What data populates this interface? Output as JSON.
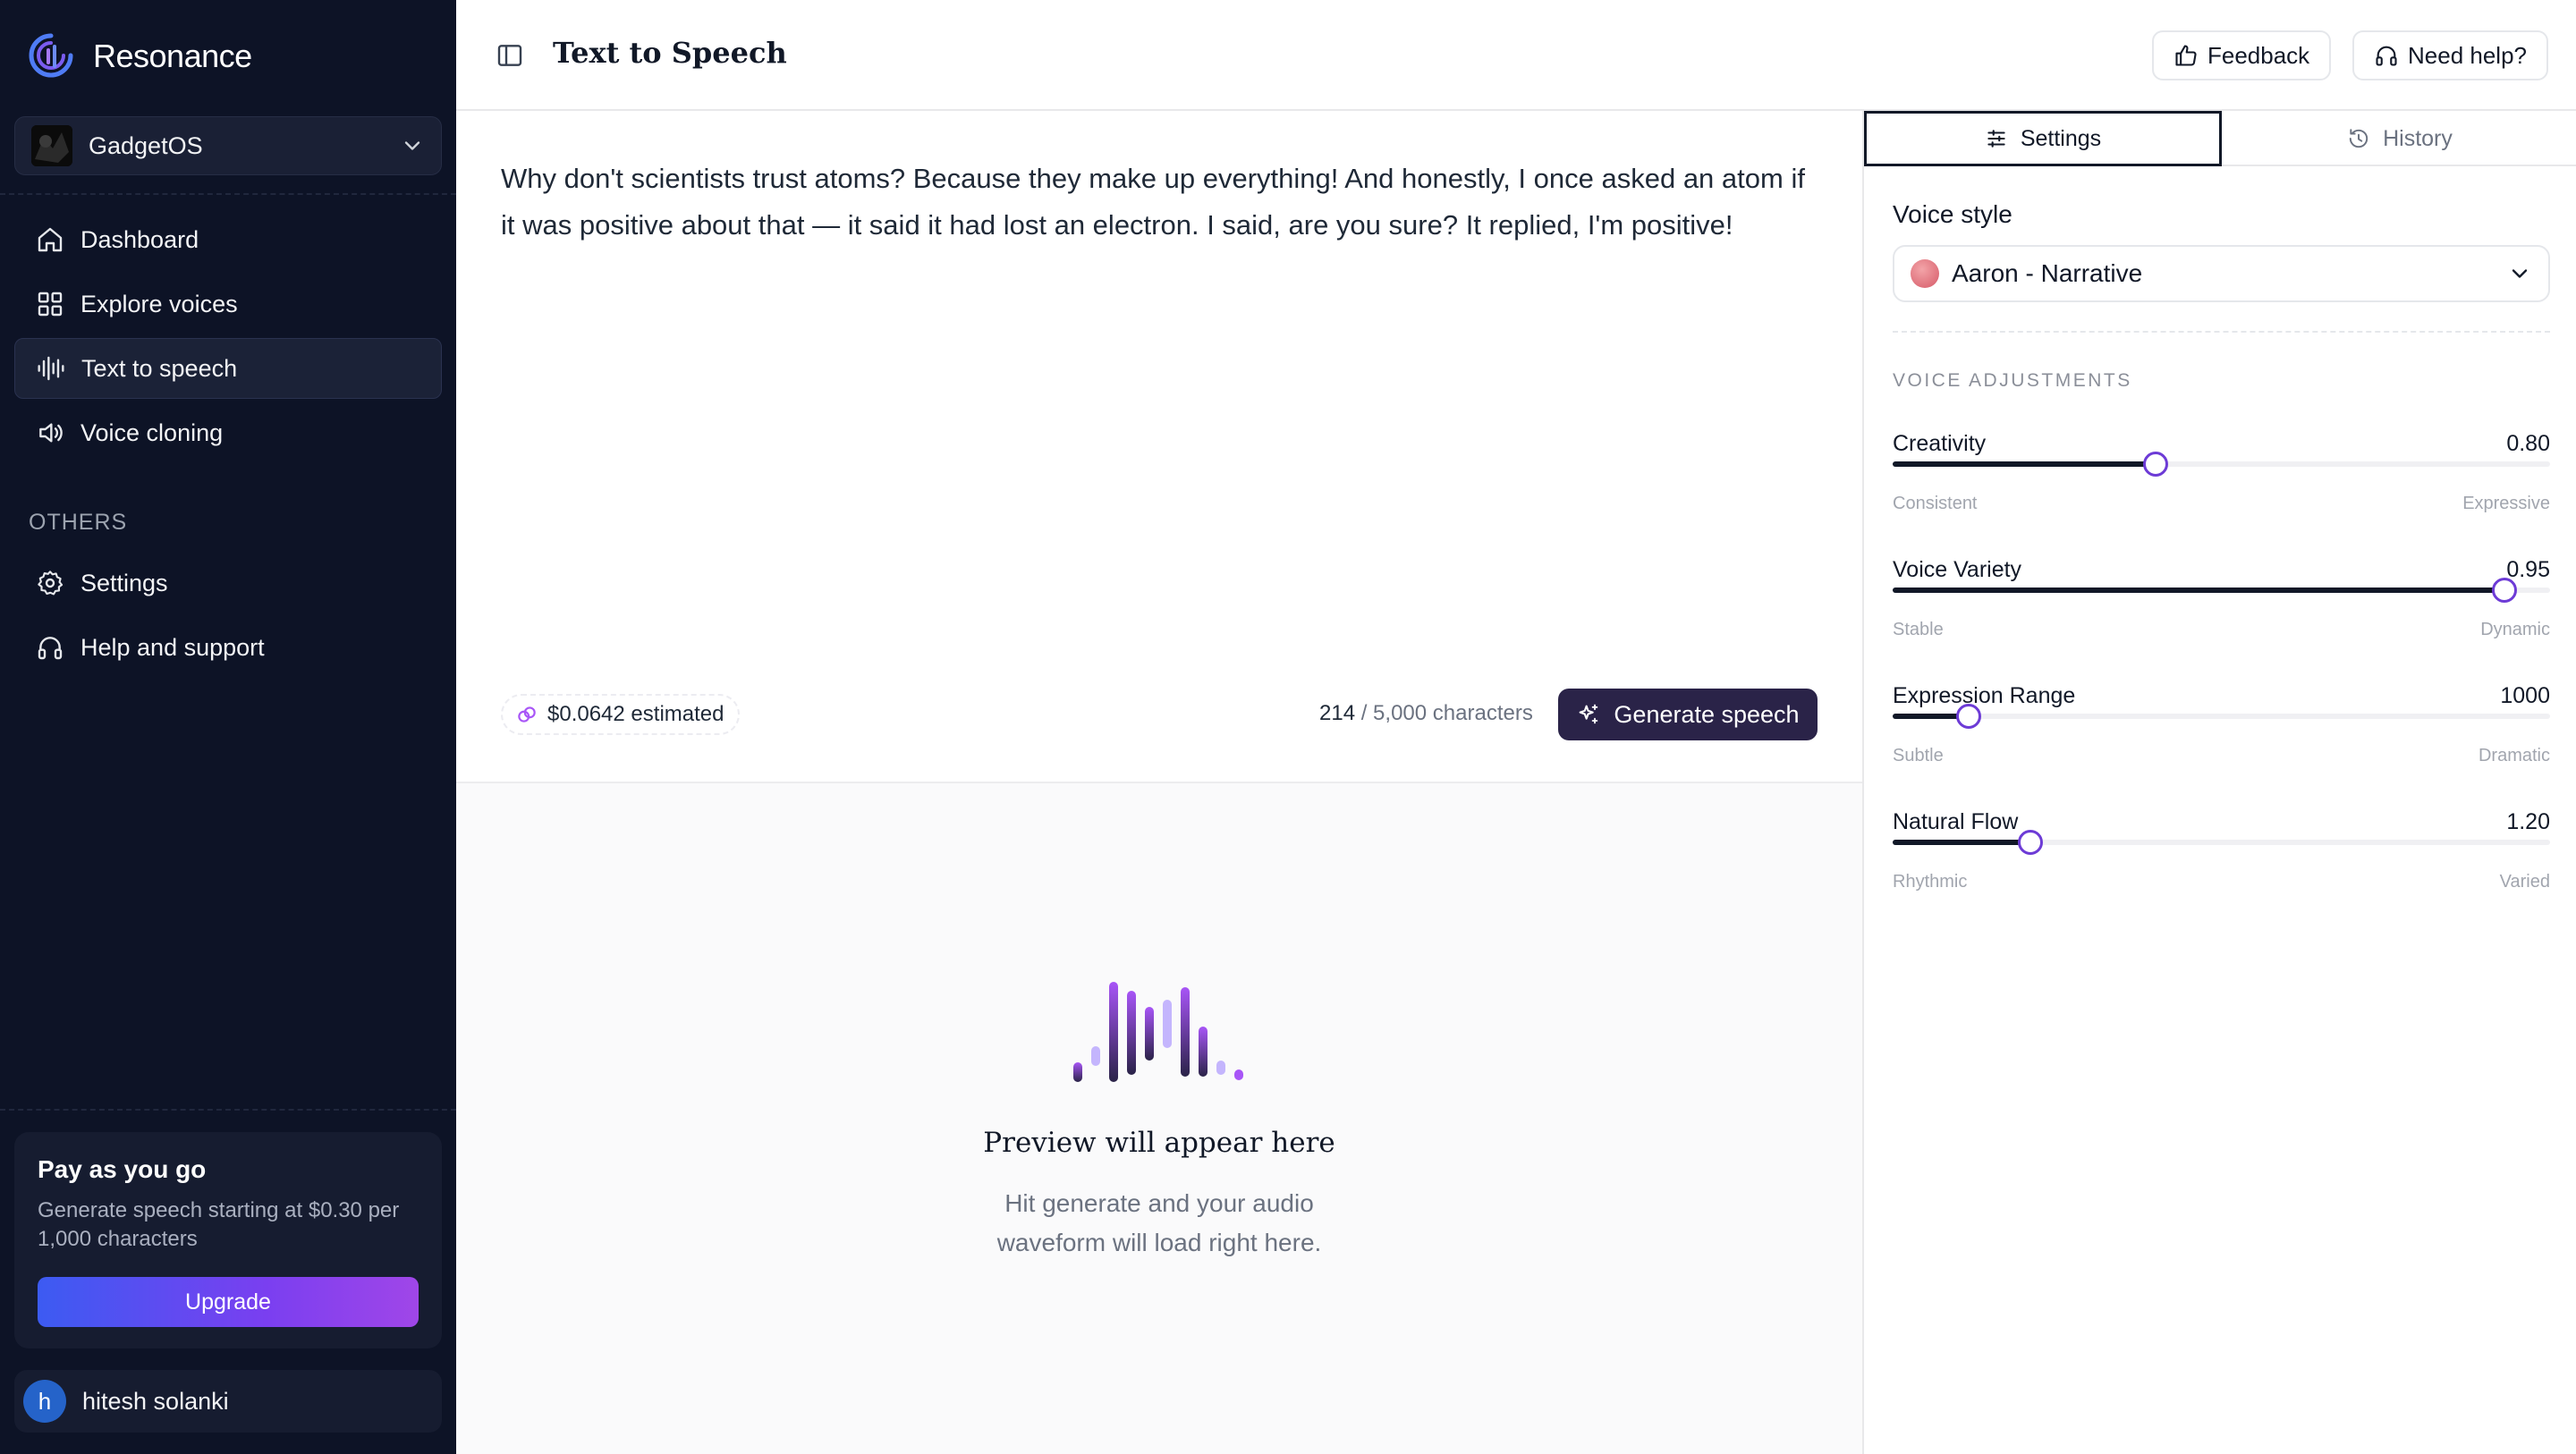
{
  "sidebar": {
    "brand": "Resonance",
    "workspace": "GadgetOS",
    "nav": [
      {
        "label": "Dashboard",
        "icon": "home-icon"
      },
      {
        "label": "Explore voices",
        "icon": "grid-icon"
      },
      {
        "label": "Text to speech",
        "icon": "waveform-icon",
        "active": true
      },
      {
        "label": "Voice cloning",
        "icon": "speaker-icon"
      }
    ],
    "others_heading": "OTHERS",
    "others": [
      {
        "label": "Settings",
        "icon": "gear-icon"
      },
      {
        "label": "Help and support",
        "icon": "headphones-icon"
      }
    ],
    "upgrade_card": {
      "title": "Pay as you go",
      "description": "Generate speech starting at $0.30 per 1,000 characters",
      "button": "Upgrade"
    },
    "user": {
      "initial": "h",
      "name": "hitesh solanki"
    }
  },
  "header": {
    "title": "Text to Speech",
    "feedback": "Feedback",
    "help": "Need help?"
  },
  "editor": {
    "text": "Why don't scientists trust atoms? Because they make up everything! And honestly, I once asked an atom if it was positive about that — it said it had lost an electron. I said, are you sure? It replied, I'm positive!",
    "cost": "$0.0642 estimated",
    "char_used": "214",
    "char_limit": "/ 5,000 characters",
    "generate": "Generate speech"
  },
  "preview": {
    "title": "Preview will appear here",
    "description_line1": "Hit generate and your audio",
    "description_line2": "waveform will load right here."
  },
  "panel": {
    "tabs": {
      "settings": "Settings",
      "history": "History"
    },
    "voice_style_label": "Voice style",
    "voice_selected": "Aaron - Narrative",
    "adjustments_title": "VOICE ADJUSTMENTS",
    "sliders": [
      {
        "name": "Creativity",
        "value": "0.80",
        "level": 0.4,
        "min_label": "Consistent",
        "max_label": "Expressive"
      },
      {
        "name": "Voice Variety",
        "value": "0.95",
        "level": 0.93,
        "min_label": "Stable",
        "max_label": "Dynamic"
      },
      {
        "name": "Expression Range",
        "value": "1000",
        "level": 0.115,
        "min_label": "Subtle",
        "max_label": "Dramatic"
      },
      {
        "name": "Natural Flow",
        "value": "1.20",
        "level": 0.21,
        "min_label": "Rhythmic",
        "max_label": "Varied"
      }
    ]
  },
  "colors": {
    "sidebar_bg": "#0d1326",
    "accent": "#6d3bd6",
    "generate_bg": "#2a2348"
  }
}
